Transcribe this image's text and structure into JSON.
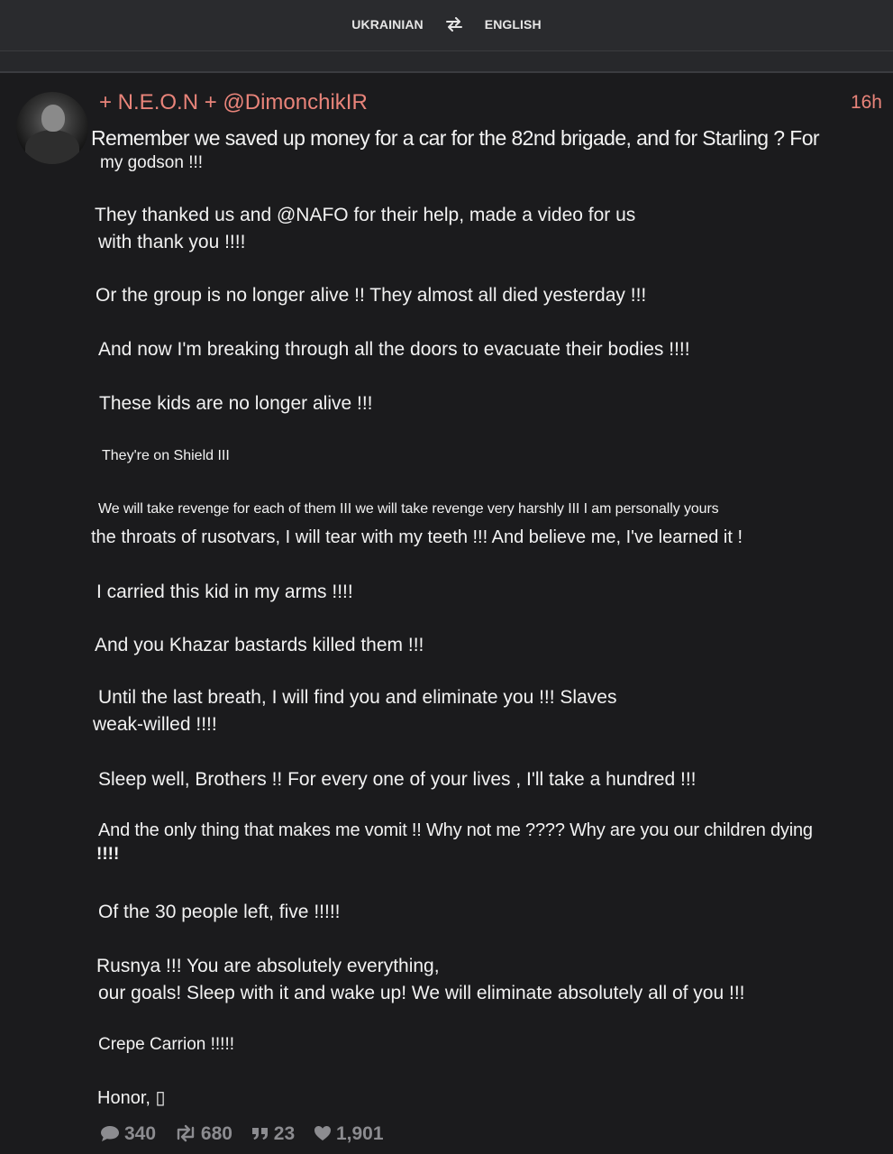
{
  "translate": {
    "source": "UKRAINIAN",
    "target": "ENGLISH",
    "swap_icon": "swap-arrows-icon"
  },
  "post": {
    "author": "+ N.E.O.N + @DimonchikIR",
    "time": "16h",
    "lines": [
      "Remember we saved up money for a car for the 82nd brigade, and for Starling ? For",
      "my godson !!!",
      "They thanked us and @NAFO for their help, made a video for us",
      "with thank you !!!!",
      "Or the group is no longer alive !! They almost all died yesterday !!!",
      "And now I'm breaking through all the doors to evacuate their bodies !!!!",
      "These kids are no longer alive !!!",
      "They're on Shield III",
      "We will take revenge for each of them III we will take revenge very harshly III I am personally yours",
      "the throats of rusotvars, I will tear with my teeth !!! And believe me, I've learned it !",
      "I carried this kid in my arms !!!!",
      "And you Khazar bastards killed them !!!",
      "Until the last breath, I will find you and eliminate you !!! Slaves",
      "weak-willed !!!!",
      "Sleep well, Brothers !! For every one of your lives , I'll take a hundred !!!",
      "And the only thing that makes me vomit !! Why not me ???? Why are you our children dying",
      "!!!!",
      "Of the 30 people left, five !!!!!",
      "Rusnya !!! You are absolutely everything,",
      "our goals! Sleep with it and wake up! We will eliminate absolutely all of you !!!",
      "Crepe Carrion !!!!!",
      "Honor, ▯"
    ],
    "stats": {
      "comments": "340",
      "reposts": "680",
      "quotes": "23",
      "likes": "1,901"
    }
  },
  "icons": {
    "comments": "comment-bubble-icon",
    "reposts": "repost-icon",
    "quotes": "quote-icon",
    "likes": "heart-icon"
  },
  "colors": {
    "background": "#1b1b1d",
    "author": "#e9847a",
    "stats": "#8c8c90"
  }
}
